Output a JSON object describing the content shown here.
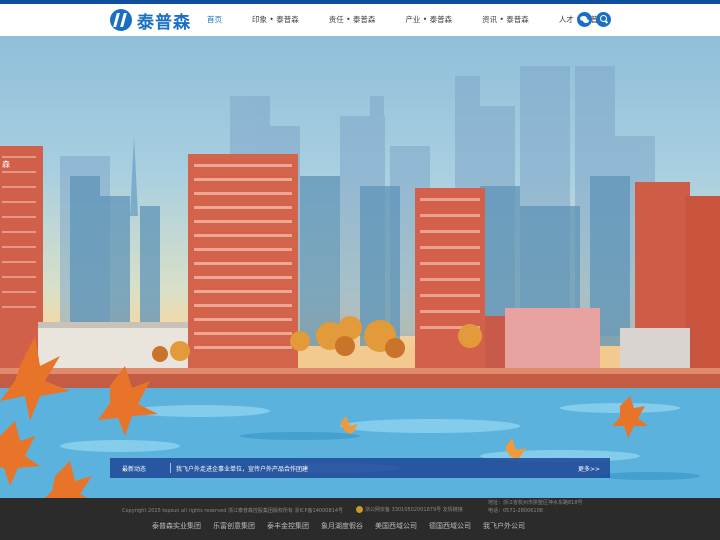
{
  "brand": {
    "name": "泰普森",
    "color": "#1a6fc4"
  },
  "nav": [
    {
      "label": "首页"
    },
    {
      "label": "印象 • 泰普森"
    },
    {
      "label": "责任 • 泰普森"
    },
    {
      "label": "产业 • 泰普森"
    },
    {
      "label": "资讯 • 泰普森"
    },
    {
      "label": "人才 • 泰普森"
    }
  ],
  "header_icons": [
    "wechat-icon",
    "search-icon"
  ],
  "hero": {
    "sign_text": "森"
  },
  "news": {
    "label": "最新动态",
    "headline": "我飞户外走进企事业单位，宣传户外产品合作团建",
    "more": "更多>>"
  },
  "footer": {
    "copyright": "Copyright 2015 topsun all rights reserved 浙江泰普森控股集团版权所有 浙ICP备14000814号",
    "police": "浙公网安备 33010502001879号 友情链接",
    "address": "地址：浙江省杭州市拱墅区萍水东路818号",
    "phone": "电话：0571-28006108",
    "links": [
      "泰普森实业集团",
      "乐富创意集团",
      "泰丰金控集团",
      "象月湖度假谷",
      "美国西域公司",
      "德国西域公司",
      "我飞户外公司"
    ]
  }
}
